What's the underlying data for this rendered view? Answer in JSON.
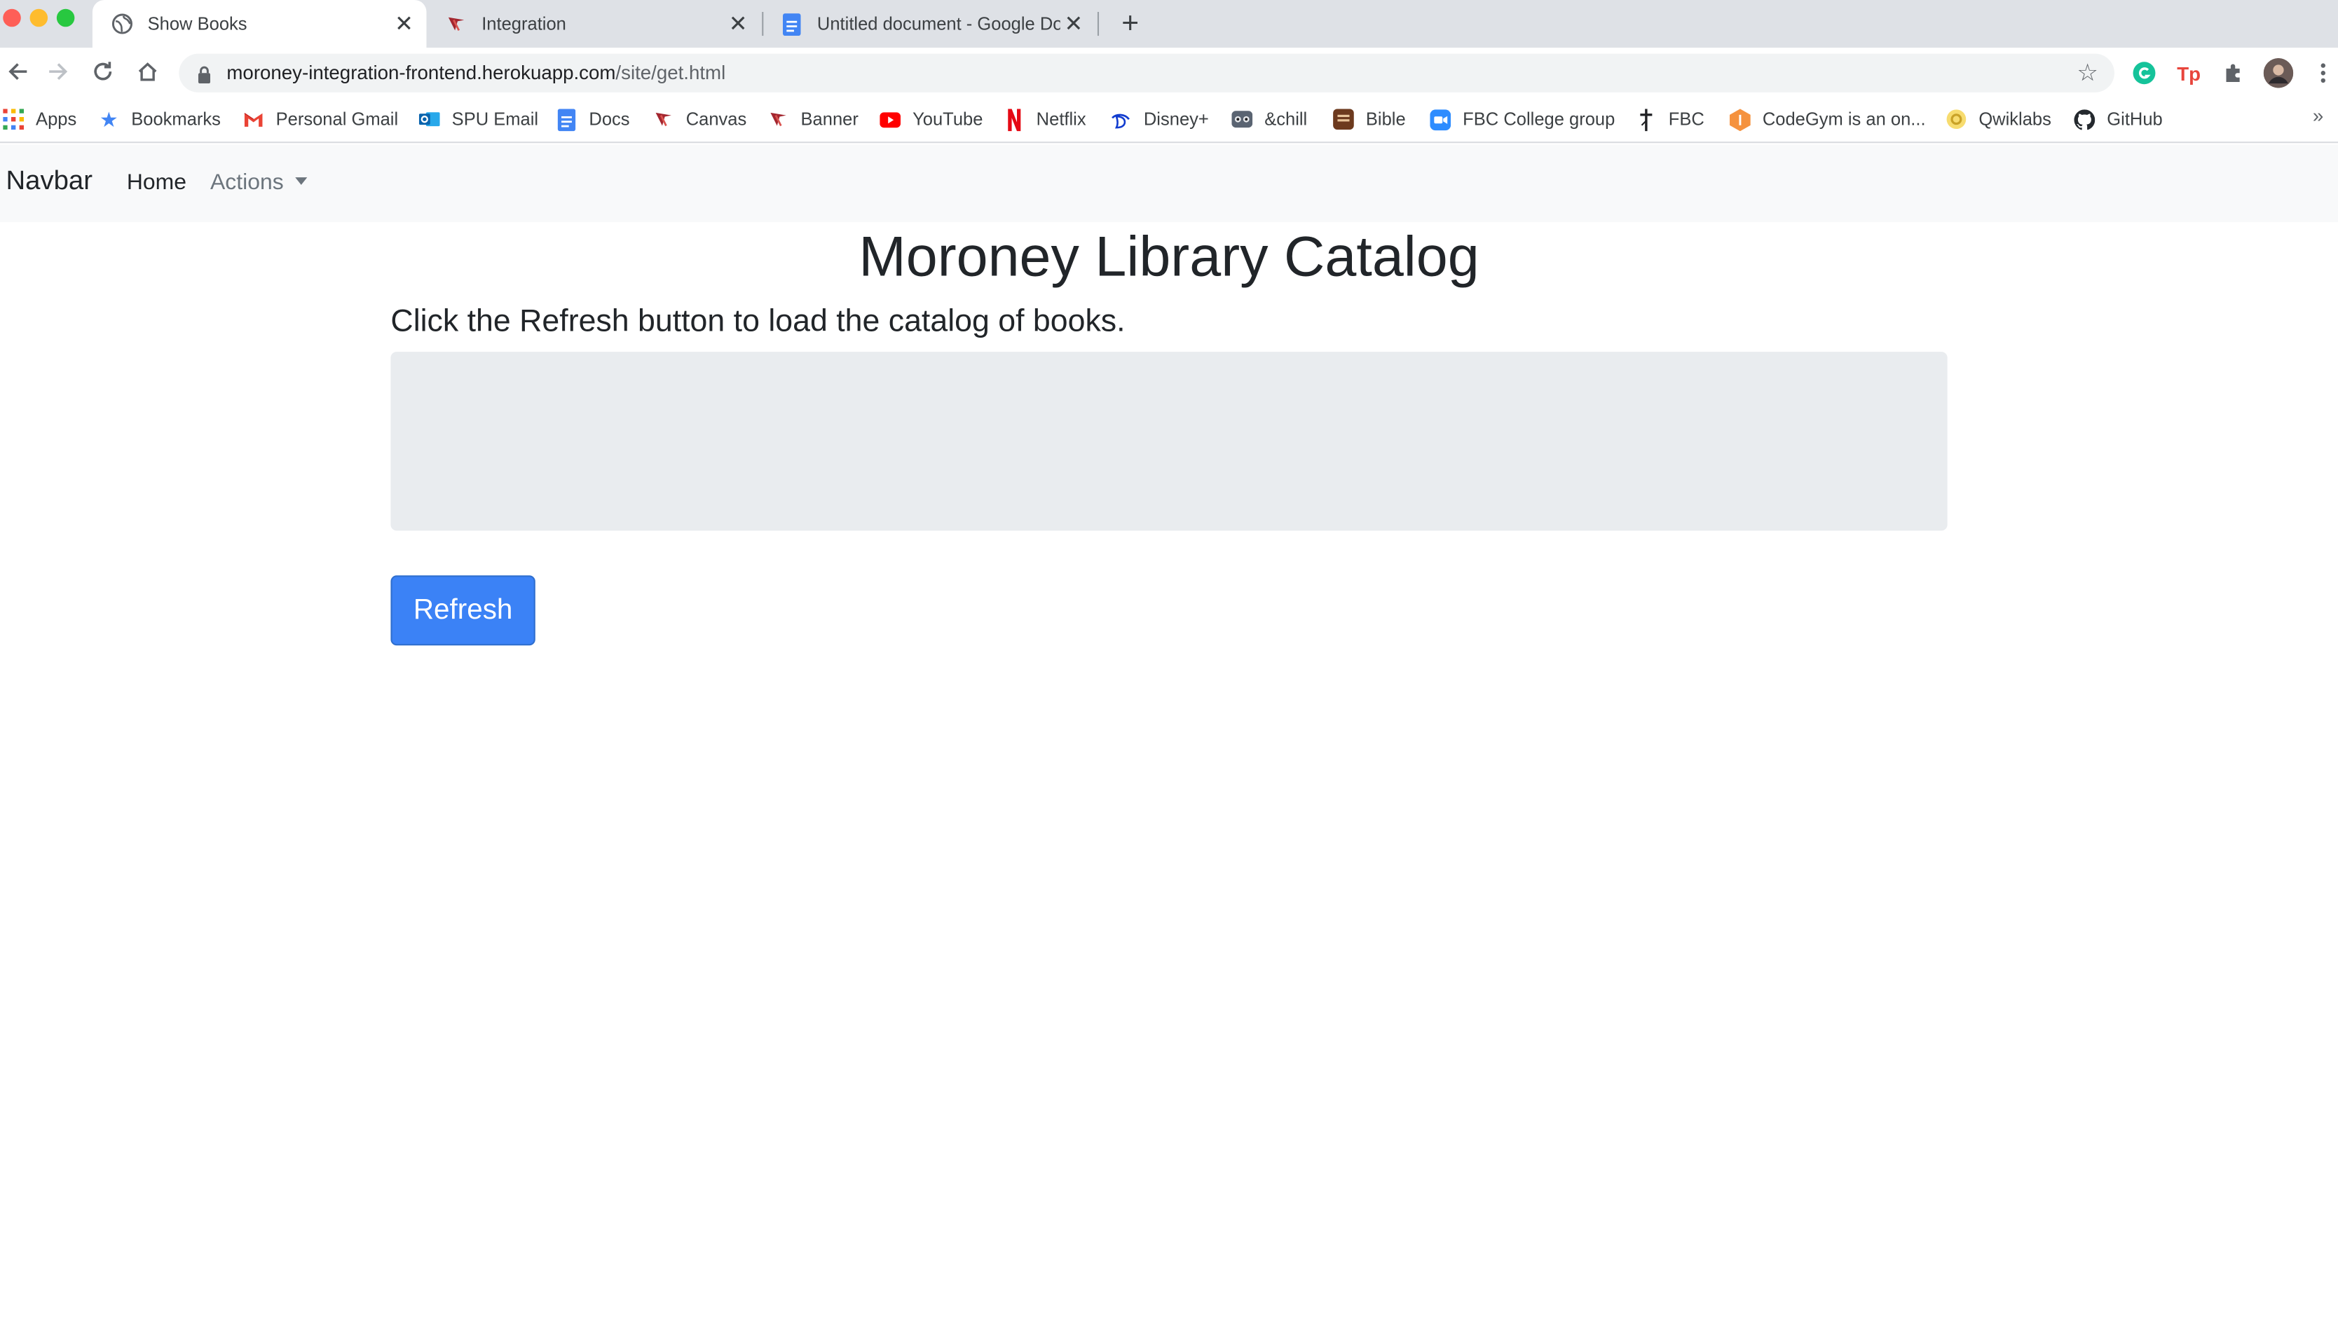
{
  "browser": {
    "tabs": [
      {
        "title": "Show Books",
        "active": true,
        "icon": "globe-icon"
      },
      {
        "title": "Integration",
        "active": false,
        "icon": "canvas-icon"
      },
      {
        "title": "Untitled document - Google Do",
        "active": false,
        "icon": "docs-icon"
      }
    ],
    "address_bar": {
      "host": "moroney-integration-frontend.herokuapp.com",
      "path": "/site/get.html"
    },
    "bookmarks": [
      {
        "label": "Apps",
        "icon": "apps-grid-icon"
      },
      {
        "label": "Bookmarks",
        "icon": "star-icon"
      },
      {
        "label": "Personal Gmail",
        "icon": "gmail-icon"
      },
      {
        "label": "SPU Email",
        "icon": "outlook-icon"
      },
      {
        "label": "Docs",
        "icon": "docs-icon"
      },
      {
        "label": "Canvas",
        "icon": "canvas-icon"
      },
      {
        "label": "Banner",
        "icon": "canvas-icon"
      },
      {
        "label": "YouTube",
        "icon": "youtube-icon"
      },
      {
        "label": "Netflix",
        "icon": "netflix-icon"
      },
      {
        "label": "Disney+",
        "icon": "disney-icon"
      },
      {
        "label": "&chill",
        "icon": "raccoon-icon"
      },
      {
        "label": "Bible",
        "icon": "bible-icon"
      },
      {
        "label": "FBC College group",
        "icon": "zoom-icon"
      },
      {
        "label": "FBC",
        "icon": "cross-icon"
      },
      {
        "label": "CodeGym is an on...",
        "icon": "codegym-icon"
      },
      {
        "label": "Qwiklabs",
        "icon": "qwiklabs-icon"
      },
      {
        "label": "GitHub",
        "icon": "github-icon"
      }
    ],
    "bookmarks_overflow": "»",
    "colors": {
      "tabstrip": "#dee1e6",
      "accent": "#3b82f6"
    }
  },
  "page": {
    "navbar": {
      "brand": "Navbar",
      "home": "Home",
      "actions": "Actions"
    },
    "title": "Moroney Library Catalog",
    "instruction": "Click the Refresh button to load the catalog of books.",
    "output_text": "",
    "refresh_label": "Refresh"
  }
}
